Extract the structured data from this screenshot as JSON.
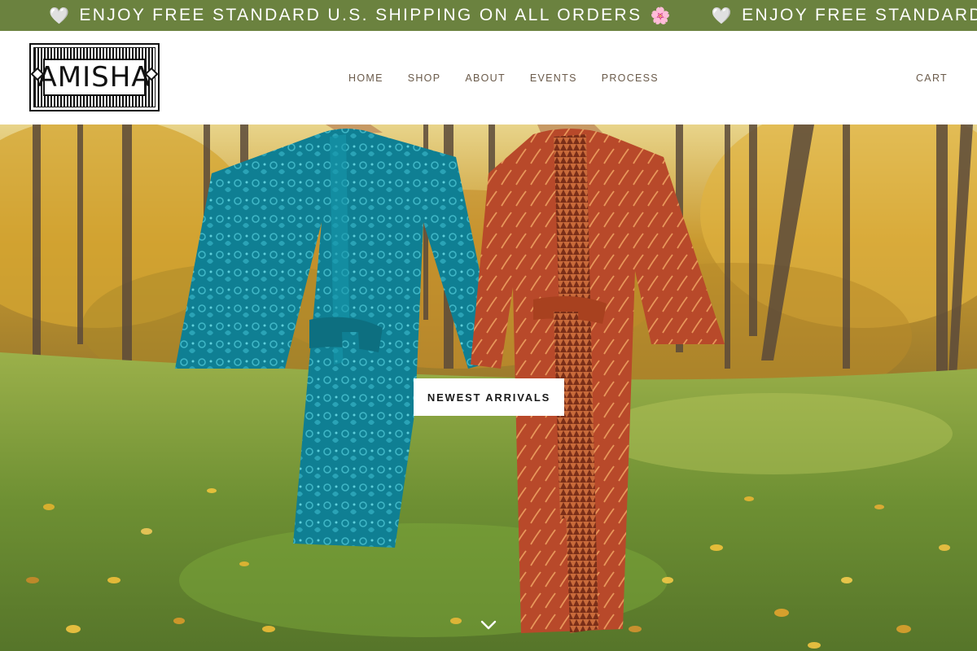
{
  "announcement": {
    "message": "ENJOY FREE STANDARD U.S. SHIPPING ON ALL ORDERS",
    "message_repeat": "ENJOY FREE STANDARD U.S. SHIPPING ON ALL ORDERS",
    "lead_emoji": "🤍",
    "trail_emoji": "🌸"
  },
  "header": {
    "logo_text": "AMISHA",
    "nav": [
      {
        "label": "HOME"
      },
      {
        "label": "SHOP"
      },
      {
        "label": "ABOUT"
      },
      {
        "label": "EVENTS"
      },
      {
        "label": "PROCESS"
      }
    ],
    "cart_label": "CART"
  },
  "hero": {
    "cta_label": "NEWEST ARRIVALS",
    "scroll_icon": "chevron-down-icon"
  },
  "colors": {
    "announcement_bg": "#6b823f",
    "nav_text": "#6a5a4a",
    "robe_teal": "#128ea3",
    "robe_rust": "#c0522a"
  }
}
